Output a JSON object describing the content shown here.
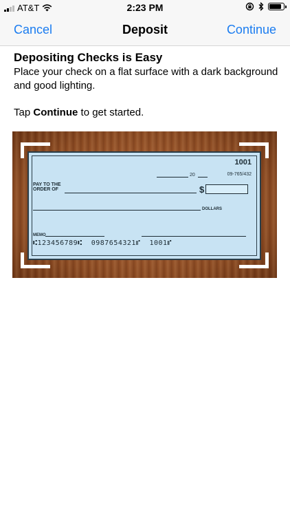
{
  "status_bar": {
    "carrier": "AT&T",
    "time": "2:23 PM"
  },
  "nav": {
    "left_label": "Cancel",
    "title": "Deposit",
    "right_label": "Continue",
    "accent_color": "#1a7cf0"
  },
  "content": {
    "heading": "Depositing Checks is Easy",
    "description": "Place your check on a flat surface with a dark background and good lighting.",
    "tap_prefix": "Tap ",
    "tap_bold": "Continue",
    "tap_suffix": " to get started."
  },
  "check": {
    "number": "1001",
    "routing_fraction": "09-765/432",
    "date_year_prefix": "20",
    "pay_label": "PAY TO THE ORDER OF",
    "dollar_sign": "$",
    "dollars_label": "DOLLARS",
    "memo_label": "MEMO",
    "micr_line": "⑆123456789⑆  0987654321⑈  1001⑈"
  }
}
